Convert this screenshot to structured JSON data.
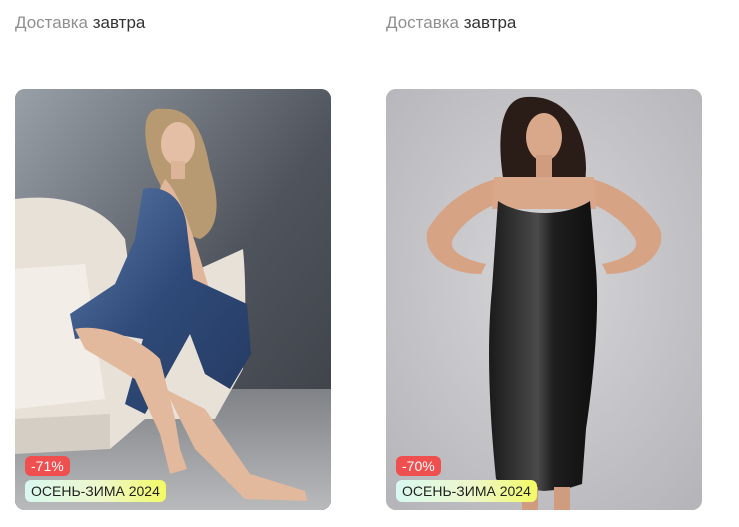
{
  "products": [
    {
      "delivery_prefix": "Доставка",
      "delivery_when": "завтра",
      "discount_badge": "-71%",
      "season_badge": "ОСЕНЬ-ЗИМА 2024",
      "photo_desc": "woman in navy satin slip dress sitting on armchair"
    },
    {
      "delivery_prefix": "Доставка",
      "delivery_when": "завтра",
      "discount_badge": "-70%",
      "season_badge": "ОСЕНЬ-ЗИМА 2024",
      "photo_desc": "woman in black satin slip dress standing"
    }
  ],
  "colors": {
    "discount_badge_bg": "#f04f4f",
    "season_badge_accent": "#f2fb63",
    "delivery_prefix": "#8f8f8f",
    "delivery_when": "#333333"
  }
}
